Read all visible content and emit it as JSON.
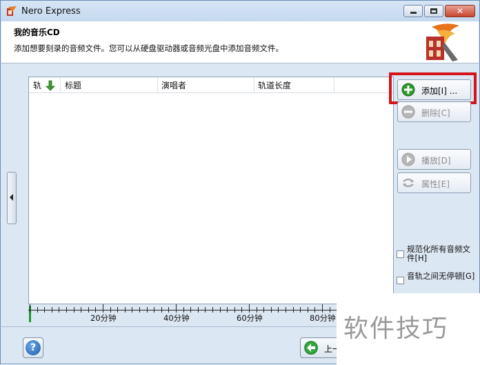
{
  "window": {
    "title": "Nero Express"
  },
  "header": {
    "title": "我的音乐CD",
    "subtitle": "添加想要刻录的音频文件。您可以从硬盘驱动器或音频光盘中添加音频文件。"
  },
  "list": {
    "columns": [
      "轨",
      "标题",
      "演唱者",
      "轨道长度"
    ]
  },
  "ruler": {
    "labels": [
      "20分钟",
      "40分钟",
      "60分钟",
      "80分钟"
    ]
  },
  "buttons": {
    "add": "添加[I] ...",
    "delete": "删除[C]",
    "play": "播放[D]",
    "properties": "属性[E]",
    "back": "上一"
  },
  "options": {
    "normalize": "规范化所有音频文件[H]",
    "no_pause": "音轨之间无停顿[G]"
  },
  "watermark": "软件技巧",
  "colors": {
    "highlight": "#d3141a",
    "add_icon": "#2e9a2e"
  }
}
